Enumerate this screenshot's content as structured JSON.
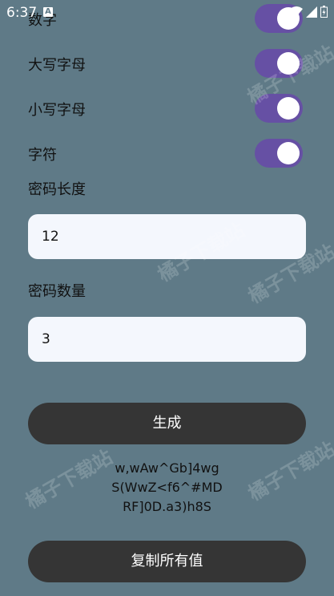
{
  "status_bar": {
    "time": "6:37",
    "notification_icon": "A"
  },
  "toggles": [
    {
      "label": "数字",
      "on": true
    },
    {
      "label": "大写字母",
      "on": true
    },
    {
      "label": "小写字母",
      "on": true
    },
    {
      "label": "字符",
      "on": true
    }
  ],
  "length_field": {
    "label": "密码长度",
    "value": "12"
  },
  "count_field": {
    "label": "密码数量",
    "value": "3"
  },
  "generate_button": {
    "label": "生成"
  },
  "results": [
    "w,wAw^Gb]4wg",
    "S(WwZ<f6^#MD",
    "RF]0D.a3)h8S"
  ],
  "copy_button": {
    "label": "复制所有值"
  },
  "watermark": {
    "text": "橘子下载站"
  },
  "colors": {
    "background": "#5f7a87",
    "switch_on": "#6650a4",
    "field_background": "#f4f7fd",
    "button_background": "#353535"
  },
  "icons": [
    "wifi-icon",
    "signal-icon",
    "battery-icon"
  ]
}
